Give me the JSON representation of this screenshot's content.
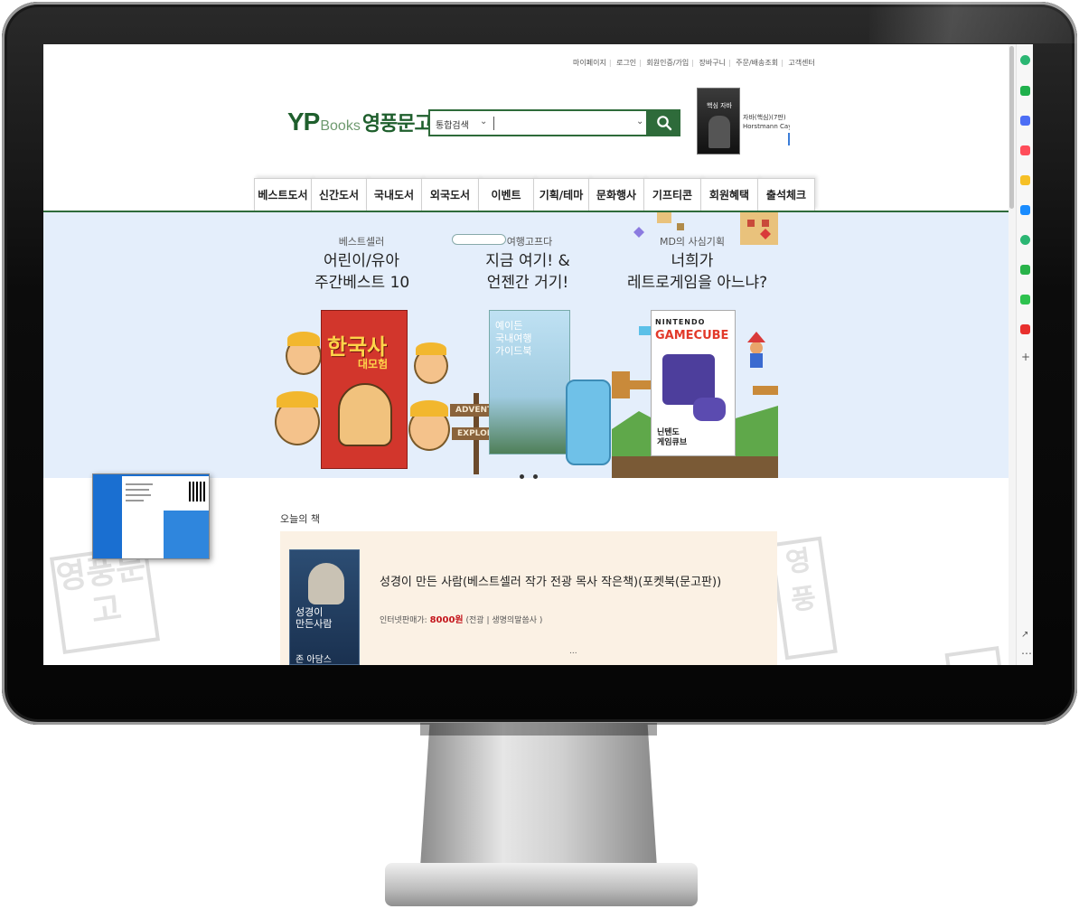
{
  "util_links": [
    "마이페이지",
    "로그인",
    "회원인증/가입",
    "장바구니",
    "주문/배송조회",
    "고객센터"
  ],
  "logo": {
    "yp": "YP",
    "books": "Books",
    "kr": "영풍문고"
  },
  "search": {
    "category": "통합검색",
    "value": ""
  },
  "ad": {
    "book_title": "핵심 자바",
    "text_line1": "자바(핵심)(7판)",
    "text_line2": "Horstmann Cay S"
  },
  "nav": [
    "베스트도서",
    "신간도서",
    "국내도서",
    "외국도서",
    "이벤트",
    "기획/테마",
    "문화행사",
    "기프티콘",
    "회원혜택",
    "출석체크"
  ],
  "banner": {
    "col1": {
      "label": "베스트셀러",
      "title1": "어린이/유아",
      "title2": "주간베스트 10",
      "book_title": "한국사",
      "book_sub": "대모험"
    },
    "col2": {
      "label": "여행고프다",
      "title1": "지금 여기! &",
      "title2": "언젠간 거기!",
      "book_title1": "예이든",
      "book_title2": "국내여행",
      "book_title3": "가이드북",
      "sign1": "ADVENTU",
      "sign2": "EXPLOR"
    },
    "col3": {
      "label": "MD의 사심기획",
      "title1": "너희가",
      "title2": "레트로게임을 아느냐?",
      "book_head": "NINTENDO",
      "book_title": "GAMECUBE",
      "book_sub1": "닌텐도",
      "book_sub2": "게임큐브"
    }
  },
  "today": {
    "label": "오늘의 책",
    "title": "성경이 만든 사람(베스트셀러 작가 전광 목사 작은책)(포켓북(문고판))",
    "price_label": "인터넷판매가:",
    "price": "8000원",
    "publisher": "(전광 | 생명의말씀사 )",
    "ellipsis": "...",
    "book_title1": "성경이",
    "book_title2": "만든사람",
    "book_bottom": "존 아담스"
  },
  "watermark": "영풍문고",
  "colors": {
    "brand_green": "#2e6b3a",
    "price_red": "#c4161c",
    "banner_bg": "#e4eefb",
    "panel_bg": "#fbf1e4"
  }
}
